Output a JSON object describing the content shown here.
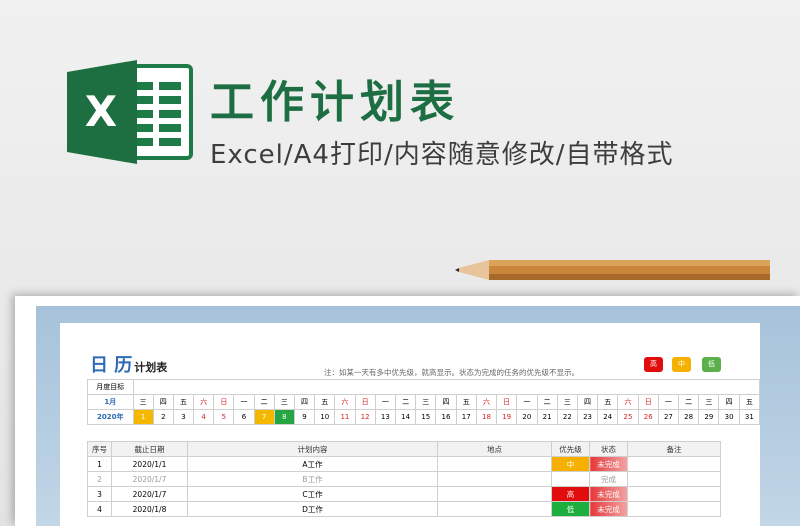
{
  "banner": {
    "title": "工作计划表",
    "subtitle": "Excel/A4打印/内容随意修改/自带格式",
    "logo_icon": "excel-logo-icon",
    "brand_color": "#1e6e43"
  },
  "sheet": {
    "title_main": "日 历",
    "title_small": "计划表",
    "note": "注：如某一天有多中优先级，就高显示。状态为完成的任务的优先级不显示。",
    "priority_buttons": [
      {
        "label": "高",
        "color": "#e10c0c"
      },
      {
        "label": "中",
        "color": "#f5b000"
      },
      {
        "label": "低",
        "color": "#5bb04a"
      }
    ],
    "goal_label": "月度目标",
    "month_label": "1月",
    "year_label": "2020年",
    "weekdays": [
      "三",
      "四",
      "五",
      "六",
      "日",
      "一",
      "二",
      "三",
      "四",
      "五",
      "六",
      "日",
      "一",
      "二",
      "三",
      "四",
      "五",
      "六",
      "日",
      "一",
      "二",
      "三",
      "四",
      "五",
      "六",
      "日",
      "一",
      "二",
      "三",
      "四",
      "五"
    ],
    "days": [
      "1",
      "2",
      "3",
      "4",
      "5",
      "6",
      "7",
      "8",
      "9",
      "10",
      "11",
      "12",
      "13",
      "14",
      "15",
      "16",
      "17",
      "18",
      "19",
      "20",
      "21",
      "22",
      "23",
      "24",
      "25",
      "26",
      "27",
      "28",
      "29",
      "30",
      "31"
    ],
    "task_headers": [
      "序号",
      "截止日期",
      "计划内容",
      "地点",
      "优先级",
      "状态",
      "备注"
    ],
    "tasks": [
      {
        "no": "1",
        "date": "2020/1/1",
        "content": "A工作",
        "place": "",
        "priority": "中",
        "status": "未完成",
        "remark": ""
      },
      {
        "no": "2",
        "date": "2020/1/7",
        "content": "B工作",
        "place": "",
        "priority": "",
        "status": "完成",
        "remark": ""
      },
      {
        "no": "3",
        "date": "2020/1/7",
        "content": "C工作",
        "place": "",
        "priority": "高",
        "status": "未完成",
        "remark": ""
      },
      {
        "no": "4",
        "date": "2020/1/8",
        "content": "D工作",
        "place": "",
        "priority": "低",
        "status": "未完成",
        "remark": ""
      }
    ]
  }
}
